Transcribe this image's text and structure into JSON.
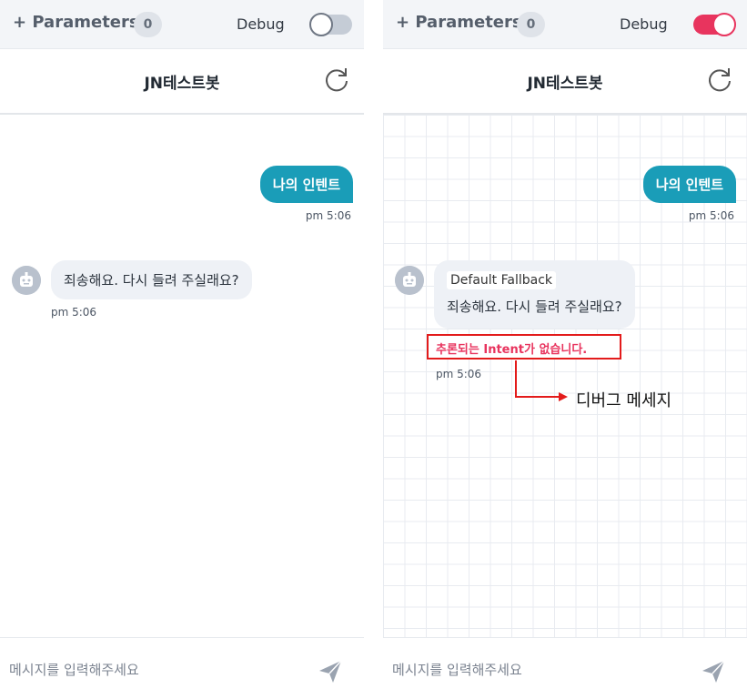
{
  "panels": [
    {
      "header": {
        "parameters_label": "+ Parameters",
        "parameters_count": "0",
        "debug_label": "Debug",
        "debug_on": false
      },
      "bot_name": "JN테스트봇",
      "user_message": {
        "text": "나의 인텐트",
        "time": "pm 5:06"
      },
      "bot_message": {
        "text": "죄송해요. 다시 들려 주실래요?",
        "time": "pm 5:06"
      },
      "input": {
        "placeholder": "메시지를 입력해주세요"
      }
    },
    {
      "header": {
        "parameters_label": "+ Parameters",
        "parameters_count": "0",
        "debug_label": "Debug",
        "debug_on": true
      },
      "bot_name": "JN테스트봇",
      "user_message": {
        "text": "나의 인텐트",
        "time": "pm 5:06"
      },
      "bot_message": {
        "intent_tag": "Default Fallback",
        "text": "죄송해요. 다시 들려 주실래요?",
        "debug_text": "추론되는 Intent가 없습니다.",
        "time": "pm 5:06"
      },
      "input": {
        "placeholder": "메시지를 입력해주세요"
      }
    }
  ],
  "annotation": {
    "label": "디버그 메세지",
    "color": "#e31b1b"
  },
  "colors": {
    "accent": "#1a9db8",
    "toggle_on": "#e8345e",
    "debug_text": "#e8345e"
  },
  "icons": {
    "refresh": "refresh-icon",
    "send": "send-icon",
    "avatar": "bot-avatar-icon"
  }
}
